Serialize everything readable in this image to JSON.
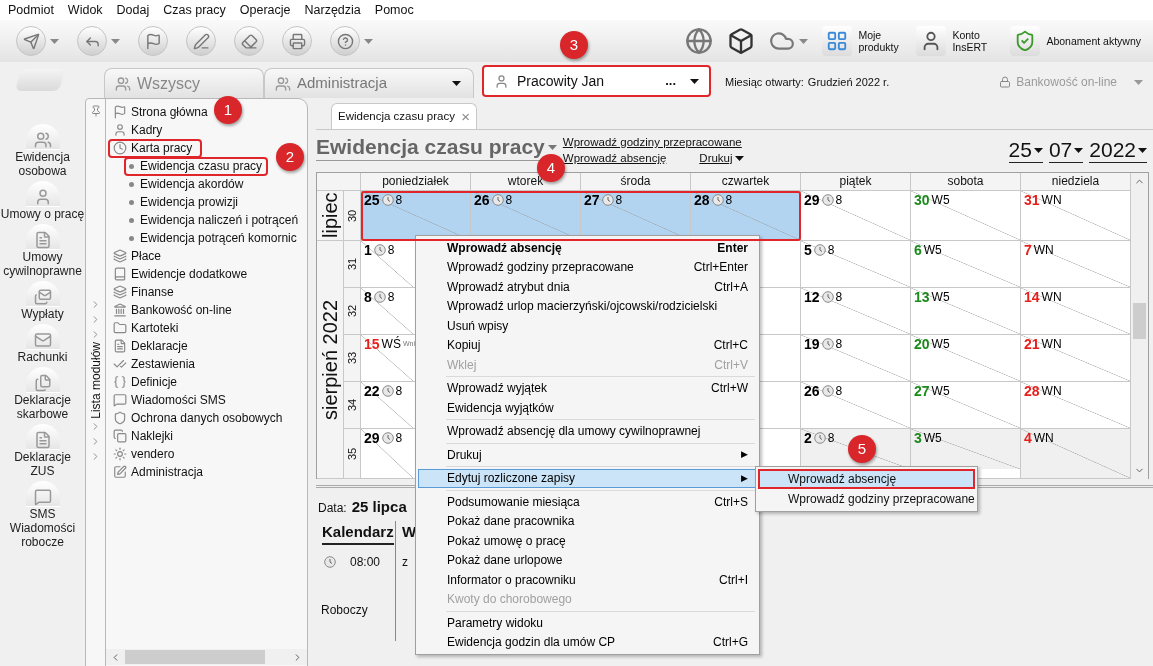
{
  "menu_bar": [
    "Podmiot",
    "Widok",
    "Dodaj",
    "Czas pracy",
    "Operacje",
    "Narzędzia",
    "Pomoc"
  ],
  "toolbar_right": [
    {
      "label": "Moje produkty"
    },
    {
      "label": "Konto InsERT"
    },
    {
      "label": "Abonament aktywny"
    }
  ],
  "context_tabs": [
    {
      "label": "Wszyscy",
      "kind": "tab"
    },
    {
      "label": "Administracja",
      "kind": "dropdown"
    }
  ],
  "employee": {
    "name": "Pracowity Jan",
    "more": "...",
    "highlighted": true
  },
  "open_month": {
    "label": "Miesiąc otwarty:",
    "value": "Grudzień 2022 r."
  },
  "banking": {
    "label": "Bankowość on-line",
    "disabled": true
  },
  "side_modules": [
    "Ewidencja osobowa",
    "Umowy o pracę",
    "Umowy cywilnoprawne",
    "Wypłaty",
    "Rachunki",
    "Deklaracje skarbowe",
    "Deklaracje ZUS",
    "SMS Wiadomości robocze"
  ],
  "tree": {
    "label": "Lista modułów",
    "items": [
      {
        "label": "Strona główna",
        "highlighted": false
      },
      {
        "label": "Kadry",
        "highlighted": false
      },
      {
        "label": "Karta pracy",
        "highlighted": true,
        "children": [
          {
            "label": "Ewidencja czasu pracy",
            "highlighted": true
          },
          {
            "label": "Ewidencja akordów",
            "highlighted": false
          },
          {
            "label": "Ewidencja prowizji",
            "highlighted": false
          },
          {
            "label": "Ewidencja naliczeń i potrąceń",
            "highlighted": false
          },
          {
            "label": "Ewidencja potrąceń komornic",
            "highlighted": false
          }
        ]
      },
      {
        "label": "Płace",
        "highlighted": false
      },
      {
        "label": "Ewidencje dodatkowe",
        "highlighted": false
      },
      {
        "label": "Finanse",
        "highlighted": false
      },
      {
        "label": "Bankowość on-line",
        "highlighted": false
      },
      {
        "label": "Kartoteki",
        "highlighted": false
      },
      {
        "label": "Deklaracje",
        "highlighted": false
      },
      {
        "label": "Zestawienia",
        "highlighted": false
      },
      {
        "label": "Definicje",
        "highlighted": false
      },
      {
        "label": "Wiadomości SMS",
        "highlighted": false
      },
      {
        "label": "Ochrona danych osobowych",
        "highlighted": false
      },
      {
        "label": "Naklejki",
        "highlighted": false
      },
      {
        "label": "vendero",
        "highlighted": false
      },
      {
        "label": "Administracja",
        "highlighted": false
      }
    ]
  },
  "document_tab": {
    "title": "Ewidencja czasu pracy",
    "close": "×"
  },
  "view": {
    "title": "Ewidencja czasu pracy",
    "links": [
      "Wprowadź godziny przepracowane",
      "Wprowadź absencję"
    ],
    "print": "Drukuj",
    "day": "25",
    "month": "07",
    "year": "2022"
  },
  "calendar": {
    "selection_highlighted": true,
    "weekdays": [
      "poniedziałek",
      "wtorek",
      "środa",
      "czwartek",
      "piątek",
      "sobota",
      "niedziela"
    ],
    "months": [
      {
        "label": "lipiec",
        "weeks": [
          {
            "number": "30",
            "cells": [
              {
                "day": "25",
                "kind": "work",
                "text": "8",
                "selected": true
              },
              {
                "day": "26",
                "kind": "work",
                "text": "8",
                "selected": true
              },
              {
                "day": "27",
                "kind": "work",
                "text": "8",
                "selected": true
              },
              {
                "day": "28",
                "kind": "work",
                "text": "8",
                "selected": true
              },
              {
                "day": "29",
                "kind": "work",
                "text": "8",
                "selected": false
              },
              {
                "day": "30",
                "kind": "saturday",
                "text": "W5",
                "selected": false
              },
              {
                "day": "31",
                "kind": "holiday",
                "text": "WN",
                "selected": false
              }
            ]
          }
        ]
      },
      {
        "label": "sierpień 2022",
        "weeks": [
          {
            "number": "31",
            "cells": [
              {
                "day": "1",
                "kind": "work",
                "text": "8",
                "selected": false
              },
              null,
              null,
              null,
              {
                "day": "5",
                "kind": "work",
                "text": "8",
                "selected": false
              },
              {
                "day": "6",
                "kind": "saturday",
                "text": "W5",
                "selected": false
              },
              {
                "day": "7",
                "kind": "holiday",
                "text": "WN",
                "selected": false
              }
            ]
          },
          {
            "number": "32",
            "cells": [
              {
                "day": "8",
                "kind": "work",
                "text": "8",
                "selected": false
              },
              null,
              null,
              null,
              {
                "day": "12",
                "kind": "work",
                "text": "8",
                "selected": false
              },
              {
                "day": "13",
                "kind": "saturday",
                "text": "W5",
                "selected": false
              },
              {
                "day": "14",
                "kind": "holiday",
                "text": "WN",
                "selected": false
              }
            ]
          },
          {
            "number": "33",
            "cells": [
              {
                "day": "15",
                "kind": "holiday",
                "text": "WŚ",
                "note": "Wni",
                "selected": false
              },
              null,
              null,
              null,
              {
                "day": "19",
                "kind": "work",
                "text": "8",
                "selected": false
              },
              {
                "day": "20",
                "kind": "saturday",
                "text": "W5",
                "selected": false
              },
              {
                "day": "21",
                "kind": "holiday",
                "text": "WN",
                "selected": false
              }
            ]
          },
          {
            "number": "34",
            "cells": [
              {
                "day": "22",
                "kind": "work",
                "text": "8",
                "selected": false
              },
              null,
              null,
              null,
              {
                "day": "26",
                "kind": "work",
                "text": "8",
                "selected": false
              },
              {
                "day": "27",
                "kind": "saturday",
                "text": "W5",
                "selected": false
              },
              {
                "day": "28",
                "kind": "holiday",
                "text": "WN",
                "selected": false
              }
            ]
          },
          {
            "number": "35",
            "cells": [
              {
                "day": "29",
                "kind": "work",
                "text": "8",
                "selected": false
              },
              null,
              null,
              null,
              {
                "day": "2",
                "kind": "work",
                "text": "8",
                "selected": false,
                "other_month": true
              },
              {
                "day": "3",
                "kind": "saturday",
                "text": "W5",
                "selected": false,
                "other_month": true
              },
              {
                "day": "4",
                "kind": "holiday",
                "text": "WN",
                "selected": false,
                "other_month": true
              }
            ]
          }
        ]
      }
    ]
  },
  "details": {
    "date_label": "Data:",
    "date": "25 lipca",
    "calendar_header": "Kalendarz",
    "column_2_header": "W",
    "start_time": "08:00",
    "column_2_text": "z",
    "day_type": "Roboczy"
  },
  "context_menu": [
    {
      "kind": "default",
      "label": "Wprowadź absencję",
      "shortcut": "Enter",
      "disabled": false,
      "selected": false
    },
    {
      "kind": "item",
      "label": "Wprowadź godziny przepracowane",
      "shortcut": "Ctrl+Enter",
      "disabled": false,
      "selected": false
    },
    {
      "kind": "item",
      "label": "Wprowadź atrybut dnia",
      "shortcut": "Ctrl+A",
      "disabled": false,
      "selected": false
    },
    {
      "kind": "item",
      "label": "Wprowadź urlop macierzyński/ojcowski/rodzicielski",
      "disabled": false,
      "selected": false
    },
    {
      "kind": "item",
      "label": "Usuń wpisy",
      "disabled": false,
      "selected": false
    },
    {
      "kind": "item",
      "label": "Kopiuj",
      "shortcut": "Ctrl+C",
      "disabled": false,
      "selected": false
    },
    {
      "kind": "item",
      "label": "Wklej",
      "shortcut": "Ctrl+V",
      "disabled": true,
      "selected": false
    },
    {
      "kind": "separator"
    },
    {
      "kind": "item",
      "label": "Wprowadź wyjątek",
      "shortcut": "Ctrl+W",
      "disabled": false,
      "selected": false
    },
    {
      "kind": "item",
      "label": "Ewidencja wyjątków",
      "disabled": false,
      "selected": false
    },
    {
      "kind": "separator"
    },
    {
      "kind": "item",
      "label": "Wprowadź absencję dla umowy cywilnoprawnej",
      "disabled": false,
      "selected": false
    },
    {
      "kind": "separator"
    },
    {
      "kind": "submenu",
      "label": "Drukuj",
      "arrow": "▶",
      "disabled": false,
      "selected": false
    },
    {
      "kind": "separator"
    },
    {
      "kind": "submenu",
      "label": "Edytuj rozliczone zapisy",
      "arrow": "▶",
      "disabled": false,
      "selected": true
    },
    {
      "kind": "separator"
    },
    {
      "kind": "item",
      "label": "Podsumowanie miesiąca",
      "shortcut": "Ctrl+S",
      "disabled": false,
      "selected": false
    },
    {
      "kind": "item",
      "label": "Pokaż dane pracownika",
      "disabled": false,
      "selected": false
    },
    {
      "kind": "item",
      "label": "Pokaż umowę o pracę",
      "disabled": false,
      "selected": false
    },
    {
      "kind": "item",
      "label": "Pokaż dane urlopowe",
      "disabled": false,
      "selected": false
    },
    {
      "kind": "item",
      "label": "Informator o pracowniku",
      "shortcut": "Ctrl+I",
      "disabled": false,
      "selected": false
    },
    {
      "kind": "item",
      "label": "Kwoty do chorobowego",
      "disabled": true,
      "selected": false
    },
    {
      "kind": "separator"
    },
    {
      "kind": "item",
      "label": "Parametry widoku",
      "disabled": false,
      "selected": false
    },
    {
      "kind": "item",
      "label": "Ewidencja godzin dla umów CP",
      "shortcut": "Ctrl+G",
      "disabled": false,
      "selected": false
    }
  ],
  "submenu": [
    {
      "label": "Wprowadź absencję",
      "selected": true,
      "highlighted": true
    },
    {
      "label": "Wprowadź godziny przepracowane",
      "selected": false,
      "highlighted": false
    }
  ],
  "callouts": [
    "1",
    "2",
    "3",
    "4",
    "5"
  ]
}
